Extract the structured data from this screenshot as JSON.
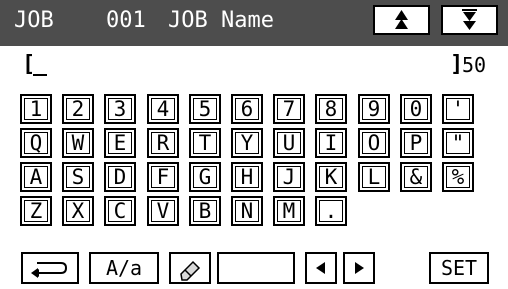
{
  "header": {
    "job_label": "JOB",
    "job_number": "001",
    "job_name": "JOB Name",
    "scroll_up_icon": "triangle-up-icon",
    "scroll_down_icon": "triangle-down-icon"
  },
  "input": {
    "open_bracket": "[",
    "close_bracket": "]",
    "max_length": "50",
    "value": ""
  },
  "keyboard": {
    "row1": [
      "1",
      "2",
      "3",
      "4",
      "5",
      "6",
      "7",
      "8",
      "9",
      "0",
      "'"
    ],
    "row2": [
      "Q",
      "W",
      "E",
      "R",
      "T",
      "Y",
      "U",
      "I",
      "O",
      "P",
      "\""
    ],
    "row3": [
      "A",
      "S",
      "D",
      "F",
      "G",
      "H",
      "J",
      "K",
      "L",
      "&",
      "%"
    ],
    "row4": [
      "Z",
      "X",
      "C",
      "V",
      "B",
      "N",
      "M",
      "."
    ]
  },
  "bottom_bar": {
    "back_icon": "return-arrow-icon",
    "case_label": "A/a",
    "erase_icon": "eraser-icon",
    "space_label": "",
    "left_icon": "triangle-left-icon",
    "right_icon": "triangle-right-icon",
    "set_label": "SET"
  }
}
